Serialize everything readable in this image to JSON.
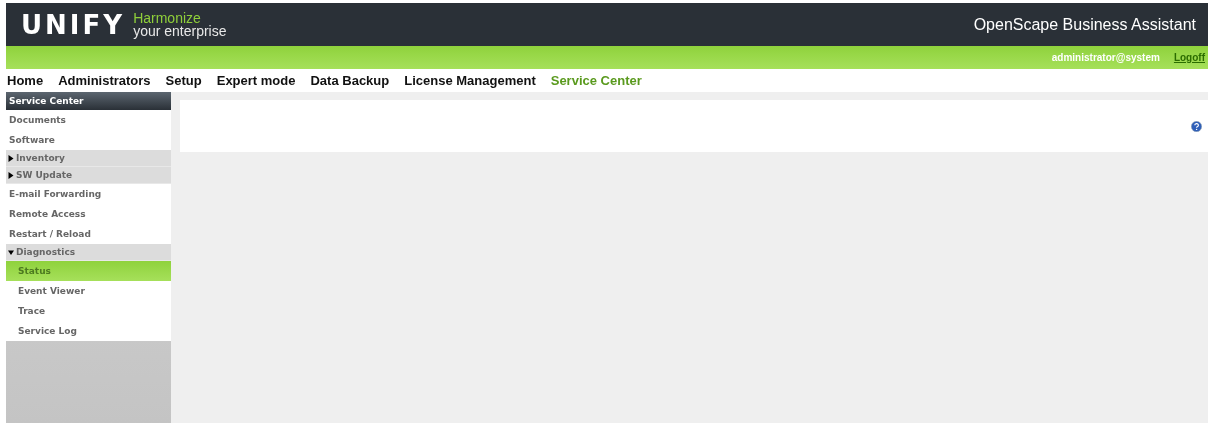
{
  "header": {
    "logo": "UNIFY",
    "tagline_top": "Harmonize",
    "tagline_bottom": "your enterprise",
    "title": "OpenScape Business Assistant"
  },
  "user_bar": {
    "user": "administrator@system",
    "logoff": "Logoff"
  },
  "nav": [
    {
      "label": "Home",
      "selected": false
    },
    {
      "label": "Administrators",
      "selected": false
    },
    {
      "label": "Setup",
      "selected": false
    },
    {
      "label": "Expert mode",
      "selected": false
    },
    {
      "label": "Data Backup",
      "selected": false
    },
    {
      "label": "License Management",
      "selected": false
    },
    {
      "label": "Service Center",
      "selected": true
    }
  ],
  "sidebar": {
    "title": "Service Center",
    "items": [
      {
        "kind": "link",
        "label": "Documents",
        "selected": false
      },
      {
        "kind": "link",
        "label": "Software",
        "selected": false
      },
      {
        "kind": "group",
        "label": "Inventory",
        "expanded": false
      },
      {
        "kind": "group",
        "label": "SW Update",
        "expanded": false
      },
      {
        "kind": "link",
        "label": "E-mail Forwarding",
        "selected": false
      },
      {
        "kind": "link",
        "label": "Remote Access",
        "selected": false
      },
      {
        "kind": "link",
        "label": "Restart / Reload",
        "selected": false
      },
      {
        "kind": "group",
        "label": "Diagnostics",
        "expanded": true,
        "children": [
          {
            "kind": "link",
            "label": "Status",
            "selected": true
          },
          {
            "kind": "link",
            "label": "Event Viewer",
            "selected": false
          },
          {
            "kind": "link",
            "label": "Trace",
            "selected": false
          },
          {
            "kind": "link",
            "label": "Service Log",
            "selected": false
          }
        ]
      }
    ]
  }
}
